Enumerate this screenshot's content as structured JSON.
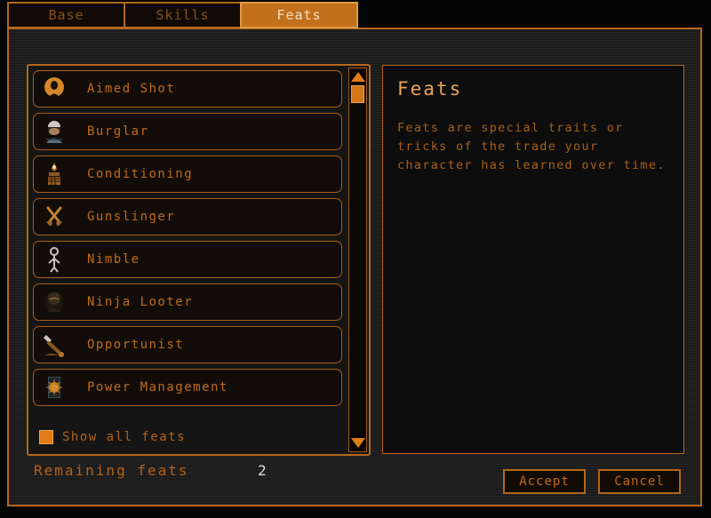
{
  "theme": {
    "accent": "#c2701c",
    "border": "#b4671b",
    "text_orange": "#c06a18",
    "text_dim": "#8a4f14",
    "text_light": "#f2ddc4",
    "bg_panel": "#1c1c1c",
    "bg_dark": "#0d0d0d",
    "value_white": "#dcdcdc"
  },
  "tabs": [
    {
      "label": "Base",
      "name": "tab-base",
      "active": false
    },
    {
      "label": "Skills",
      "name": "tab-skills",
      "active": false
    },
    {
      "label": "Feats",
      "name": "tab-feats",
      "active": true
    }
  ],
  "feat_list": {
    "items": [
      {
        "label": "Aimed Shot",
        "icon": "aimed-shot-icon"
      },
      {
        "label": "Burglar",
        "icon": "burglar-icon"
      },
      {
        "label": "Conditioning",
        "icon": "conditioning-icon"
      },
      {
        "label": "Gunslinger",
        "icon": "gunslinger-icon"
      },
      {
        "label": "Nimble",
        "icon": "nimble-icon"
      },
      {
        "label": "Ninja Looter",
        "icon": "ninja-looter-icon"
      },
      {
        "label": "Opportunist",
        "icon": "opportunist-icon"
      },
      {
        "label": "Power Management",
        "icon": "power-management-icon"
      }
    ],
    "show_all": {
      "label": "Show all feats",
      "checked": true
    },
    "scrollbar": {
      "up_icon": "triangle-up-icon",
      "down_icon": "triangle-down-icon",
      "thumb_position_percent": 0
    }
  },
  "description": {
    "title": "Feats",
    "body": "Feats are special traits or tricks of the trade your character has learned over time."
  },
  "footer": {
    "remaining_label": "Remaining feats",
    "remaining_value": "2",
    "accept_label": "Accept",
    "cancel_label": "Cancel"
  }
}
